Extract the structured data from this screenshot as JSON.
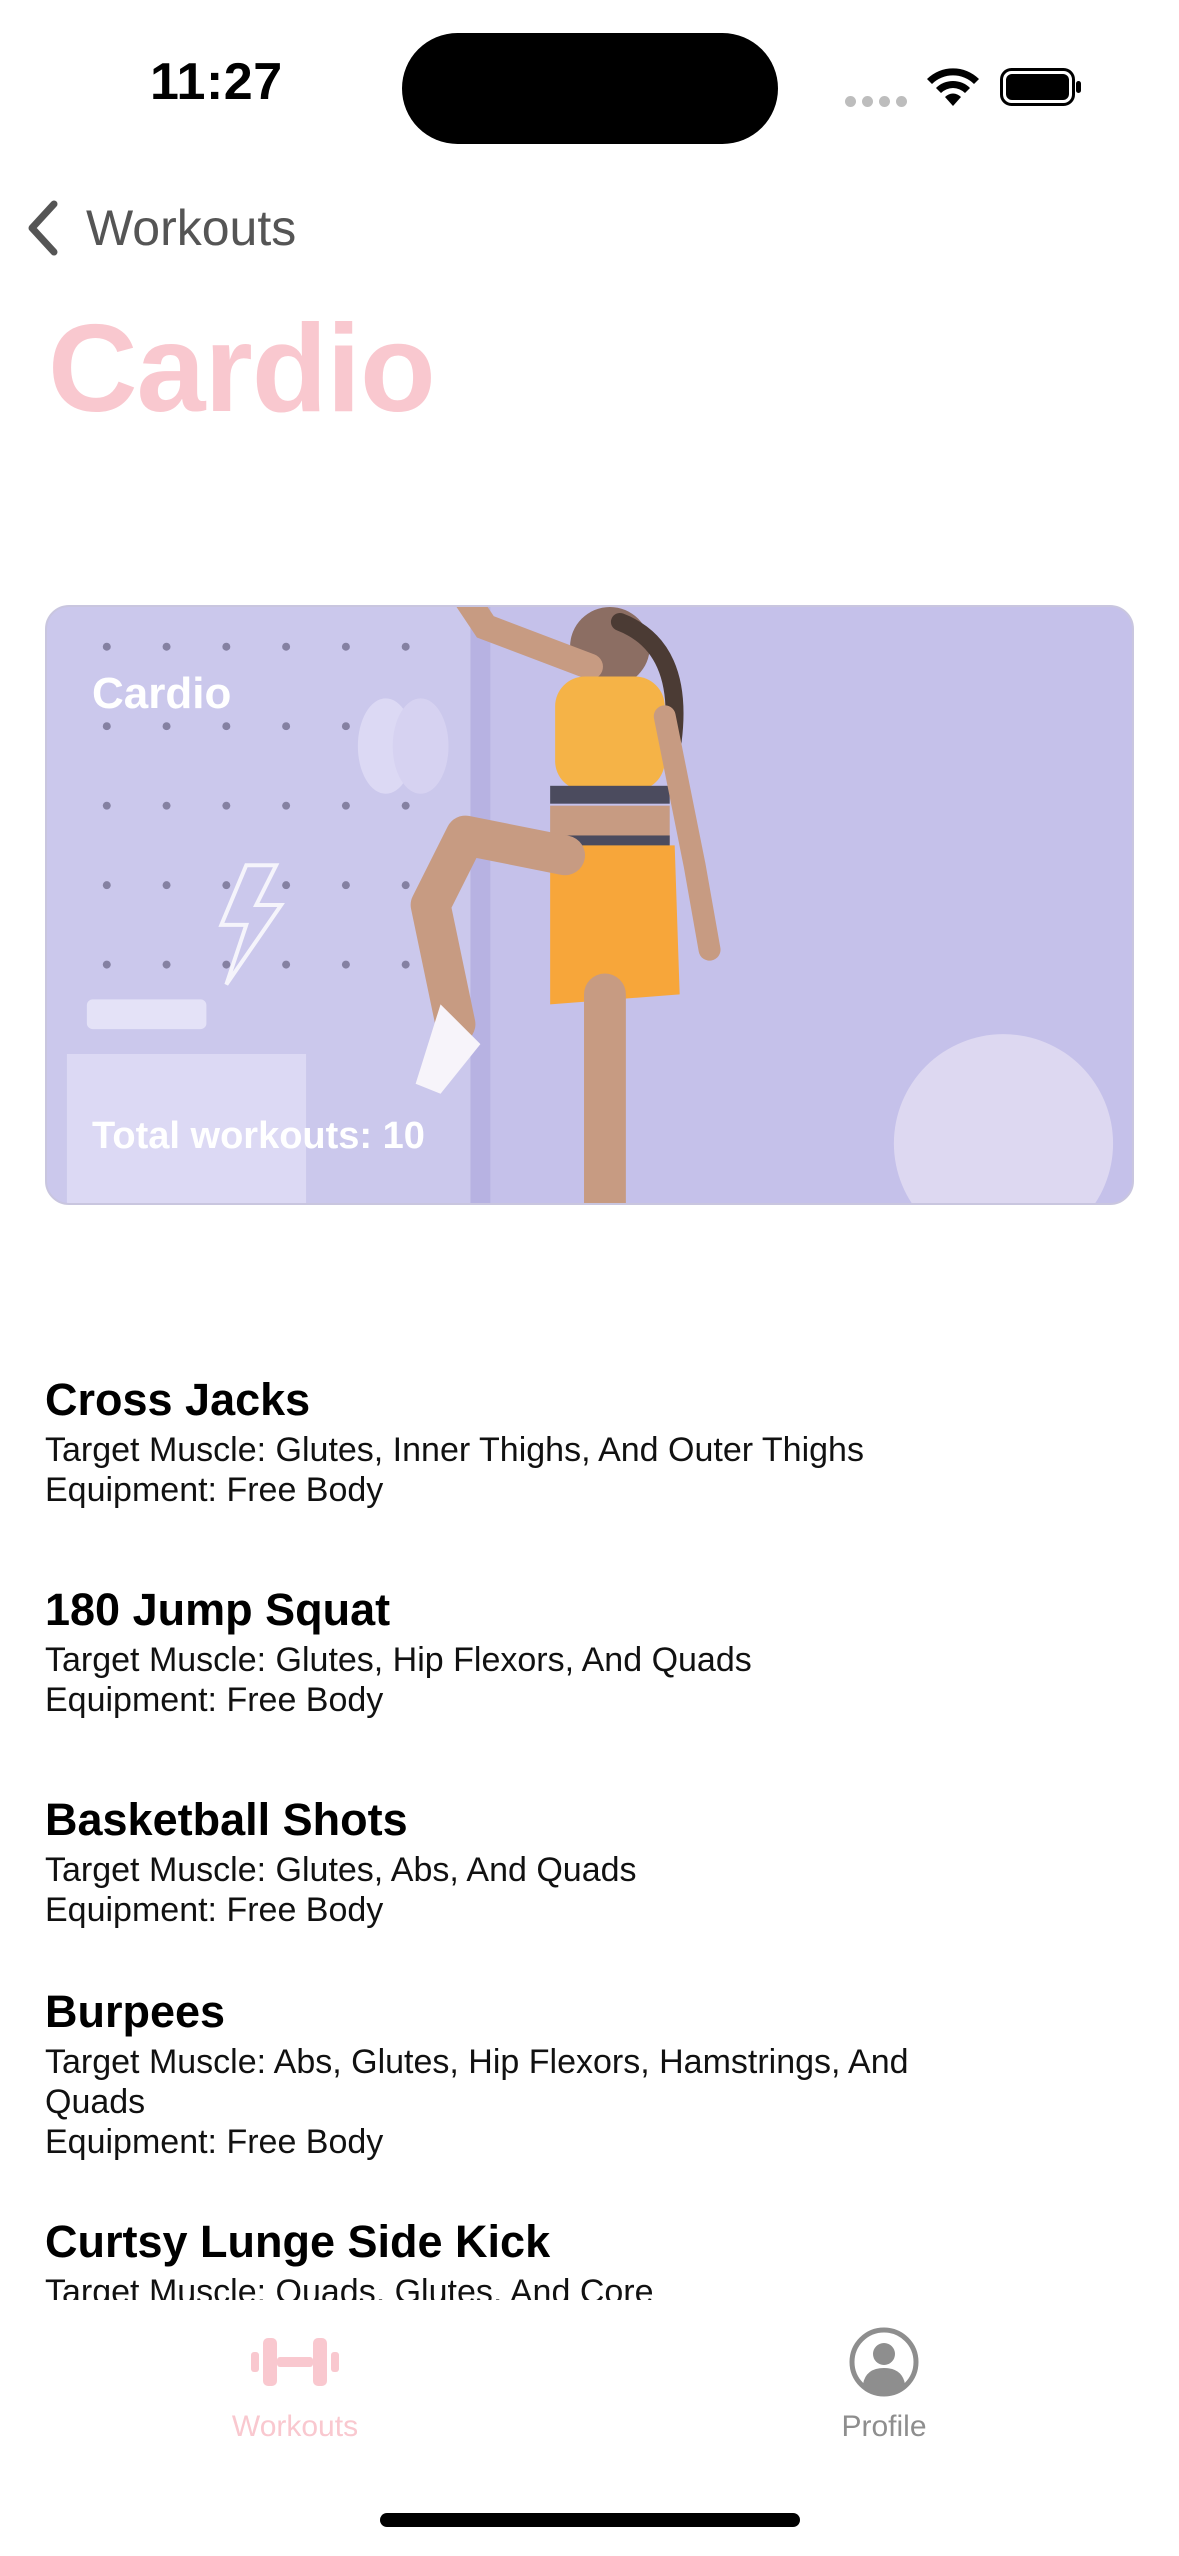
{
  "status_bar": {
    "time": "11:27"
  },
  "nav": {
    "back_label": "Workouts"
  },
  "page": {
    "title": "Cardio"
  },
  "hero": {
    "title": "Cardio",
    "total": "Total workouts: 10"
  },
  "workouts": [
    {
      "name": "Cross Jacks",
      "target": "Target Muscle: Glutes, Inner Thighs, And Outer Thighs",
      "equipment": "Equipment: Free Body"
    },
    {
      "name": "180 Jump Squat",
      "target": "Target Muscle: Glutes, Hip Flexors, And Quads",
      "equipment": "Equipment: Free Body"
    },
    {
      "name": "Basketball Shots",
      "target": "Target Muscle: Glutes, Abs, And Quads",
      "equipment": "Equipment: Free Body"
    },
    {
      "name": "Burpees",
      "target": "Target Muscle: Abs, Glutes, Hip Flexors, Hamstrings, And Quads",
      "equipment": "Equipment: Free Body"
    },
    {
      "name": "Curtsy Lunge Side Kick",
      "target": "Target Muscle: Quads, Glutes, And Core",
      "equipment": ""
    }
  ],
  "tab_bar": {
    "tabs": [
      {
        "label": "Workouts",
        "icon": "dumbbell-icon",
        "active": true
      },
      {
        "label": "Profile",
        "icon": "person-circle-icon",
        "active": false
      }
    ]
  },
  "colors": {
    "accent": "#f9c8cf",
    "card_background": "#c5c1ea",
    "inactive": "#8e8e8e"
  }
}
